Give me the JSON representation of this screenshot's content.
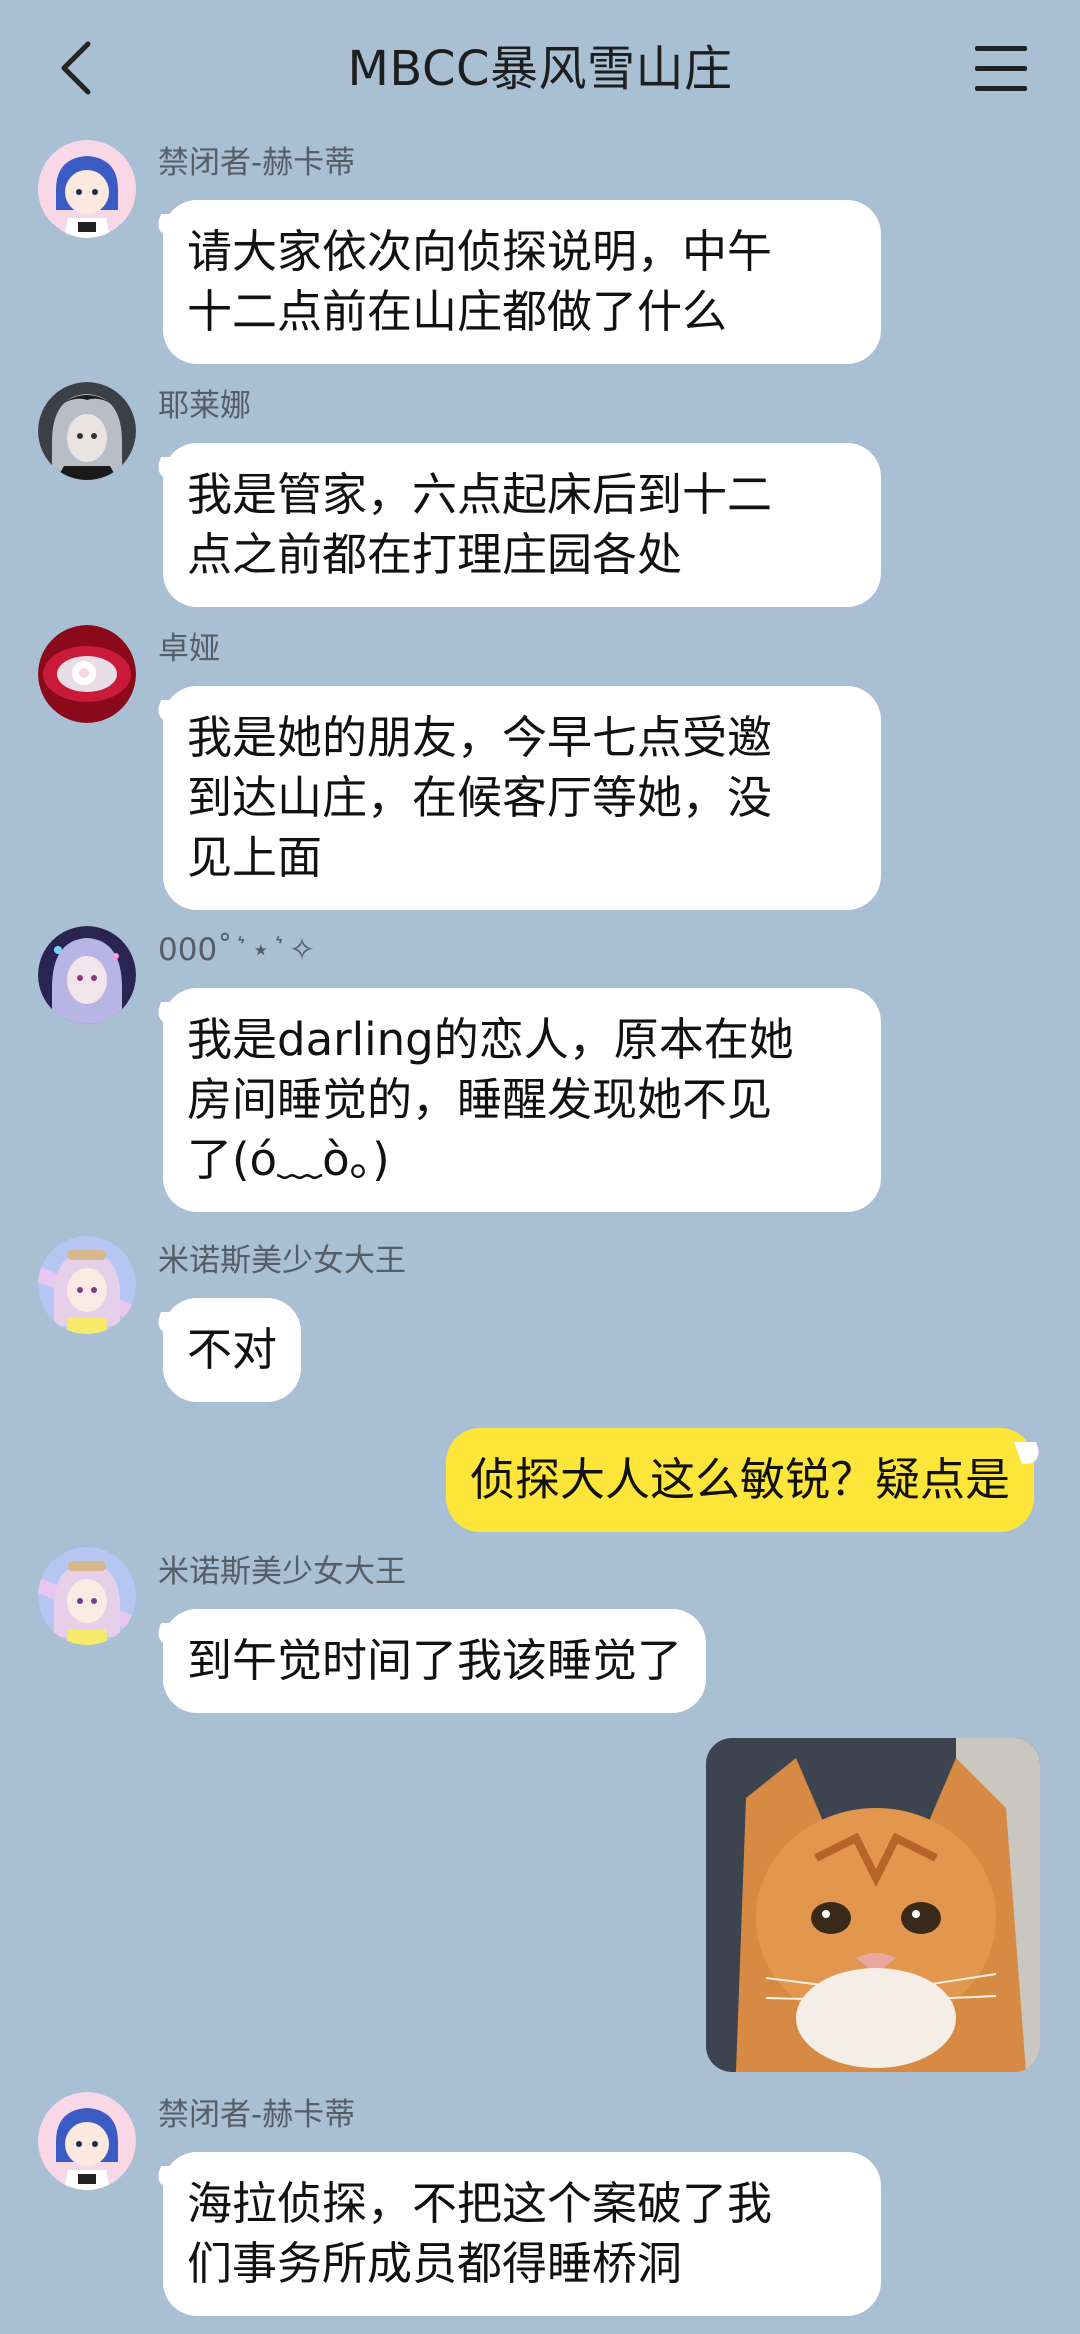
{
  "header": {
    "title": "MBCC暴风雪山庄",
    "back_icon": "chevron-left-icon",
    "menu_icon": "hamburger-menu-icon"
  },
  "messages": [
    {
      "sender": "禁闭者-赫卡蒂",
      "text": "请大家依次向侦探说明，中午十二点前在山庄都做了什么",
      "lines": [
        "请大家依次向侦探说明，中午",
        "十二点前在山庄都做了什么"
      ]
    },
    {
      "sender": "耶莱娜",
      "text": "我是管家，六点起床后到十二点之前都在打理庄园各处",
      "lines": [
        "我是管家，六点起床后到十二",
        "点之前都在打理庄园各处"
      ]
    },
    {
      "sender": "卓娅",
      "text": "我是她的朋友，今早七点受邀到达山庄，在候客厅等她，没见上面",
      "lines": [
        "我是她的朋友，今早七点受邀",
        "到达山庄，在候客厅等她，没",
        "见上面"
      ]
    },
    {
      "sender": "000˚ ͛ ⋆ ͛ ✧",
      "text": "我是darling的恋人，原本在她房间睡觉的，睡醒发现她不见了(ó﹏ò｡)",
      "lines": [
        "我是darling的恋人，原本在她",
        "房间睡觉的，睡醒发现她不见",
        "了(ó﹏ò｡)"
      ]
    },
    {
      "sender": "米诺斯美少女大王",
      "text": "不对",
      "lines": [
        "不对"
      ]
    },
    {
      "sender": "me",
      "text": "侦探大人这么敏锐？疑点是",
      "lines": [
        "侦探大人这么敏锐？疑点是"
      ]
    },
    {
      "sender": "米诺斯美少女大王",
      "text": "到午觉时间了我该睡觉了",
      "lines": [
        "到午觉时间了我该睡觉了"
      ]
    },
    {
      "sender": "me",
      "image": "sad-cat-meme-image"
    },
    {
      "sender": "禁闭者-赫卡蒂",
      "text": "海拉侦探，不把这个案破了我们事务所成员都得睡桥洞",
      "lines": [
        "海拉侦探，不把这个案破了我",
        "们事务所成员都得睡桥洞"
      ]
    }
  ],
  "colors": {
    "background": "#a9bfd3",
    "bubble_other": "#ffffff",
    "bubble_mine": "#fde53a",
    "sender_name": "#555d66"
  }
}
